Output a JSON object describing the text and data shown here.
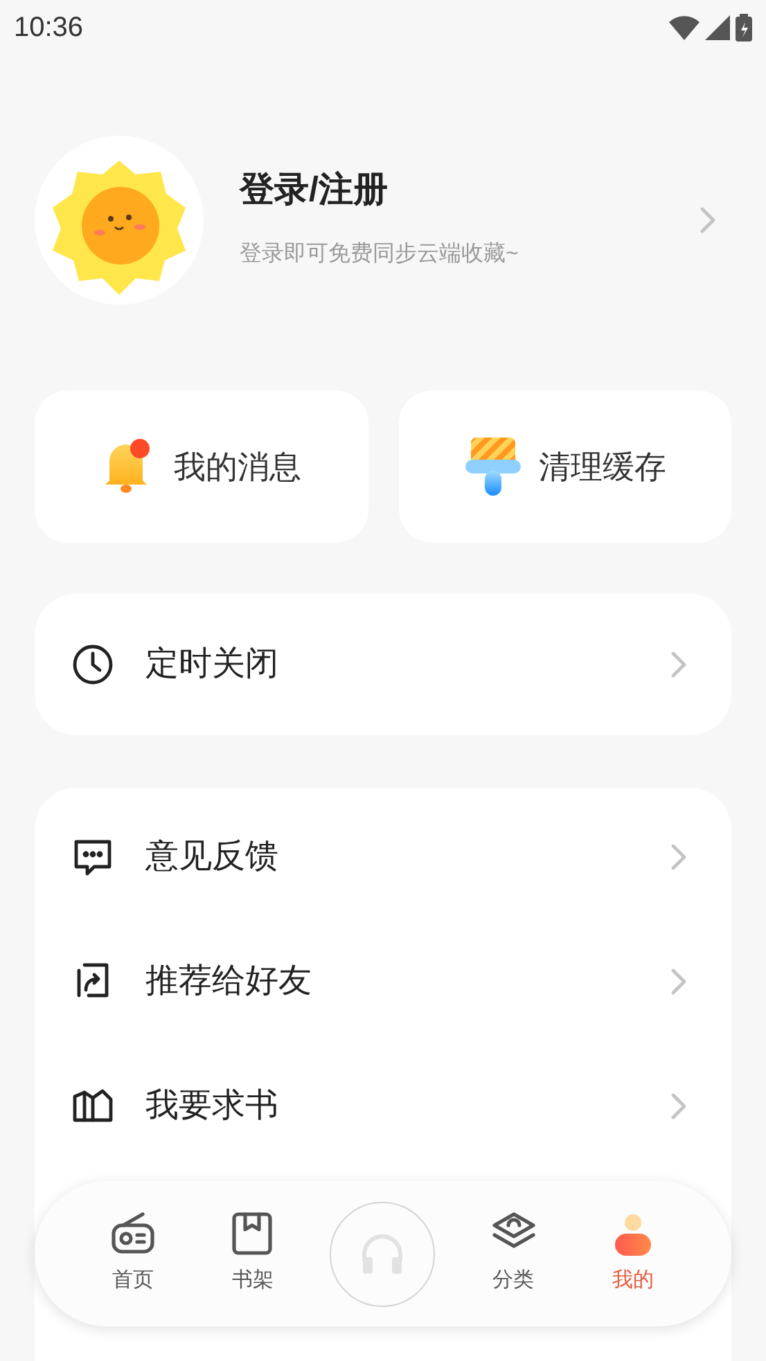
{
  "status_bar": {
    "time": "10:36"
  },
  "profile": {
    "title": "登录/注册",
    "subtitle": "登录即可免费同步云端收藏~"
  },
  "quick_actions": [
    {
      "kind": "messages",
      "label": "我的消息",
      "unread": true
    },
    {
      "kind": "cache",
      "label": "清理缓存"
    }
  ],
  "timer": {
    "label": "定时关闭"
  },
  "menu": [
    {
      "kind": "feedback",
      "label": "意见反馈"
    },
    {
      "kind": "share",
      "label": "推荐给好友"
    },
    {
      "kind": "request",
      "label": "我要求书"
    }
  ],
  "bottom_nav": [
    {
      "kind": "home",
      "label": "首页",
      "selected": false
    },
    {
      "kind": "shelf",
      "label": "书架",
      "selected": false
    },
    {
      "kind": "player"
    },
    {
      "kind": "category",
      "label": "分类",
      "selected": false
    },
    {
      "kind": "me",
      "label": "我的",
      "selected": true
    }
  ]
}
